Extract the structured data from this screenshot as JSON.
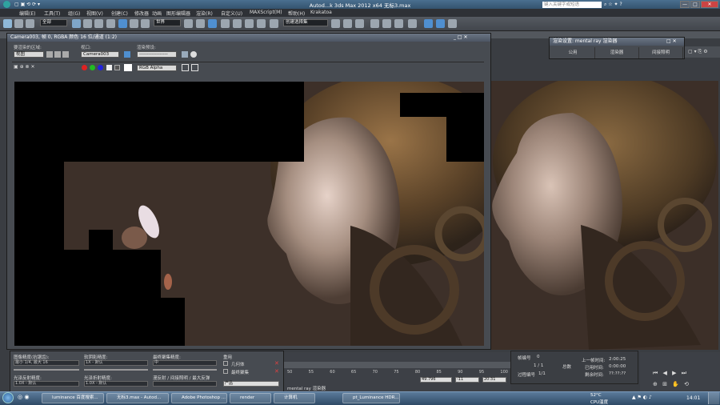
{
  "window": {
    "title": "Autod...k 3ds Max  2012 x64      无标3.max",
    "search_placeholder": "键入关键字或短语",
    "min": "—",
    "max": "□",
    "close": "✕"
  },
  "menu": [
    "编辑(E)",
    "工具(T)",
    "组(G)",
    "视图(V)",
    "创建(C)",
    "修改器",
    "动画",
    "图形编辑器",
    "渲染(R)",
    "自定义(U)",
    "MAXScript(M)",
    "帮助(H)",
    "Krakatoa"
  ],
  "toolbar": {
    "selection_filter": "全部",
    "ref_coord": "世界",
    "named_sel": "创建选择集"
  },
  "frame": {
    "title": "Camera003, 帧 0, RGBA 颜色 16 位/通道 (1:2)",
    "area_label": "要渲染的区域:",
    "area_value": "视图",
    "viewport_label": "视口:",
    "viewport_value": "Camera003",
    "preset_label": "渲染预设:",
    "preset_value": "------------------",
    "channel_value": "RGB Alpha"
  },
  "mental_ray": {
    "title": "渲染设置: mental ray 渲染器",
    "tabs": [
      "公用",
      "渲染器",
      "间接照明"
    ]
  },
  "options": {
    "sampling_label": "图像精度(抗锯齿):",
    "sampling_value": "最小 1/4, 最大 16",
    "soft_shadow_label": "软阴影精度:",
    "soft_shadow_value": "1X - 默认",
    "final_gather_label": "最终聚集精度:",
    "final_gather_value": "中",
    "reuse_label": "重用",
    "reuse_geom": "几何体",
    "reuse_fg": "最终聚集",
    "glossy_refl_label": "光泽反射精度:",
    "glossy_refl_value": "1.0X - 默认",
    "glossy_refr_label": "光泽折射精度:",
    "glossy_refr_value": "1.0X - 默认",
    "bounce_label": "漫反射 / 间接照明 / 最大反弹",
    "product": "产品",
    "render_label": "渲染",
    "footer": "mental ray 渲染器"
  },
  "timeline": {
    "ticks": [
      "50",
      "55",
      "60",
      "65",
      "70",
      "75",
      "80",
      "85",
      "90",
      "95",
      "100"
    ],
    "percent": "49.796",
    "x_val": "-11",
    "y_val": "20:31"
  },
  "stats": {
    "frame_label": "帧编号",
    "frame_value": "0",
    "passes": "1 / 1",
    "total_label": "总数",
    "process_label": "过程编号",
    "process_value": "1/1",
    "last_frame_label": "上一帧时间:",
    "last_frame_value": "2:00:25",
    "elapsed_label": "已用时间:",
    "elapsed_value": "0:00:00",
    "remaining_label": "剩余时间:",
    "remaining_value": "??:??:??"
  },
  "taskbar": {
    "items": [
      "luminance 百度搜索...",
      "无标3.max - Autod...",
      "Adobe Photoshop ...",
      "render",
      "计算机",
      "pt_Luminance HDR..."
    ],
    "clock": "14:01",
    "temp": "52°C",
    "cpu": "CPU温度"
  }
}
